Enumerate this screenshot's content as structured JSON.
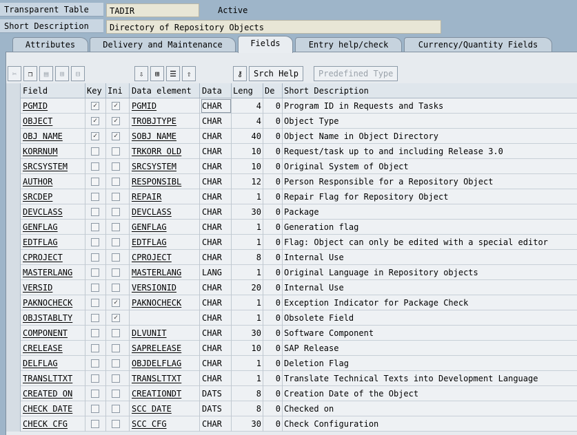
{
  "header": {
    "table_label": "Transparent Table",
    "table_value": "TADIR",
    "status": "Active",
    "desc_label": "Short Description",
    "desc_value": "Directory of Repository Objects"
  },
  "tabs": [
    "Attributes",
    "Delivery and Maintenance",
    "Fields",
    "Entry help/check",
    "Currency/Quantity Fields"
  ],
  "active_tab": "Fields",
  "toolbar": {
    "search_help": "Srch Help",
    "predefined_type": "Predefined Type"
  },
  "columns": [
    "Field",
    "Key",
    "Ini",
    "Data element",
    "Data",
    "Leng",
    "De",
    "Short Description"
  ],
  "rows": [
    {
      "field": "PGMID",
      "key": true,
      "ini": true,
      "de": "PGMID",
      "dt": "CHAR",
      "len": "4",
      "dec": "0",
      "desc": "Program ID in Requests and Tasks"
    },
    {
      "field": "OBJECT",
      "key": true,
      "ini": true,
      "de": "TROBJTYPE",
      "dt": "CHAR",
      "len": "4",
      "dec": "0",
      "desc": "Object Type"
    },
    {
      "field": "OBJ NAME",
      "key": true,
      "ini": true,
      "de": "SOBJ NAME",
      "dt": "CHAR",
      "len": "40",
      "dec": "0",
      "desc": "Object Name in Object Directory"
    },
    {
      "field": "KORRNUM",
      "key": false,
      "ini": false,
      "de": "TRKORR OLD",
      "dt": "CHAR",
      "len": "10",
      "dec": "0",
      "desc": "Request/task up to and including Release 3.0"
    },
    {
      "field": "SRCSYSTEM",
      "key": false,
      "ini": false,
      "de": "SRCSYSTEM",
      "dt": "CHAR",
      "len": "10",
      "dec": "0",
      "desc": "Original System of Object"
    },
    {
      "field": "AUTHOR",
      "key": false,
      "ini": false,
      "de": "RESPONSIBL",
      "dt": "CHAR",
      "len": "12",
      "dec": "0",
      "desc": "Person Responsible for a Repository Object"
    },
    {
      "field": "SRCDEP",
      "key": false,
      "ini": false,
      "de": "REPAIR",
      "dt": "CHAR",
      "len": "1",
      "dec": "0",
      "desc": "Repair Flag for Repository Object"
    },
    {
      "field": "DEVCLASS",
      "key": false,
      "ini": false,
      "de": "DEVCLASS",
      "dt": "CHAR",
      "len": "30",
      "dec": "0",
      "desc": "Package"
    },
    {
      "field": "GENFLAG",
      "key": false,
      "ini": false,
      "de": "GENFLAG",
      "dt": "CHAR",
      "len": "1",
      "dec": "0",
      "desc": "Generation flag"
    },
    {
      "field": "EDTFLAG",
      "key": false,
      "ini": false,
      "de": "EDTFLAG",
      "dt": "CHAR",
      "len": "1",
      "dec": "0",
      "desc": "Flag: Object can only be edited with a special editor"
    },
    {
      "field": "CPROJECT",
      "key": false,
      "ini": false,
      "de": "CPROJECT",
      "dt": "CHAR",
      "len": "8",
      "dec": "0",
      "desc": "Internal Use"
    },
    {
      "field": "MASTERLANG",
      "key": false,
      "ini": false,
      "de": "MASTERLANG",
      "dt": "LANG",
      "len": "1",
      "dec": "0",
      "desc": "Original Language in Repository objects"
    },
    {
      "field": "VERSID",
      "key": false,
      "ini": false,
      "de": "VERSIONID",
      "dt": "CHAR",
      "len": "20",
      "dec": "0",
      "desc": "Internal Use"
    },
    {
      "field": "PAKNOCHECK",
      "key": false,
      "ini": true,
      "de": "PAKNOCHECK",
      "dt": "CHAR",
      "len": "1",
      "dec": "0",
      "desc": "Exception Indicator for Package Check"
    },
    {
      "field": "OBJSTABLTY",
      "key": false,
      "ini": true,
      "de": "",
      "dt": "CHAR",
      "len": "1",
      "dec": "0",
      "desc": "Obsolete Field"
    },
    {
      "field": "COMPONENT",
      "key": false,
      "ini": false,
      "de": "DLVUNIT",
      "dt": "CHAR",
      "len": "30",
      "dec": "0",
      "desc": "Software Component"
    },
    {
      "field": "CRELEASE",
      "key": false,
      "ini": false,
      "de": "SAPRELEASE",
      "dt": "CHAR",
      "len": "10",
      "dec": "0",
      "desc": "SAP Release"
    },
    {
      "field": "DELFLAG",
      "key": false,
      "ini": false,
      "de": "OBJDELFLAG",
      "dt": "CHAR",
      "len": "1",
      "dec": "0",
      "desc": "Deletion Flag"
    },
    {
      "field": "TRANSLTTXT",
      "key": false,
      "ini": false,
      "de": "TRANSLTTXT",
      "dt": "CHAR",
      "len": "1",
      "dec": "0",
      "desc": "Translate Technical Texts into Development Language"
    },
    {
      "field": "CREATED ON",
      "key": false,
      "ini": false,
      "de": "CREATIONDT",
      "dt": "DATS",
      "len": "8",
      "dec": "0",
      "desc": "Creation Date of the Object"
    },
    {
      "field": "CHECK DATE",
      "key": false,
      "ini": false,
      "de": "SCC DATE",
      "dt": "DATS",
      "len": "8",
      "dec": "0",
      "desc": "Checked on"
    },
    {
      "field": "CHECK CFG",
      "key": false,
      "ini": false,
      "de": "SCC CFG",
      "dt": "CHAR",
      "len": "30",
      "dec": "0",
      "desc": "Check Configuration"
    }
  ]
}
